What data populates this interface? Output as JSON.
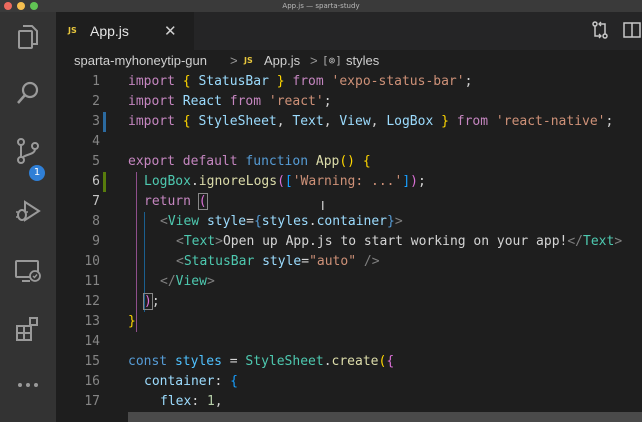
{
  "window": {
    "title": "App.js — sparta-study"
  },
  "tab": {
    "label": "App.js",
    "icon": "JS",
    "close": "✕"
  },
  "breadcrumb": {
    "folder": "sparta-myhoneytip-gun",
    "file": "App.js",
    "symbol": "styles",
    "separator": ">"
  },
  "scm": {
    "badge": "1"
  },
  "line_numbers": [
    "1",
    "2",
    "3",
    "4",
    "5",
    "6",
    "7",
    "8",
    "9",
    "10",
    "11",
    "12",
    "13",
    "14",
    "15",
    "16",
    "17"
  ],
  "code": {
    "l1": {
      "a": "import",
      "b": " { ",
      "c": "StatusBar",
      "d": " } ",
      "e": "from",
      "f": " ",
      "g": "'expo-status-bar'",
      "h": ";"
    },
    "l2": {
      "a": "import",
      "b": " ",
      "c": "React",
      "d": " ",
      "e": "from",
      "f": " ",
      "g": "'react'",
      "h": ";"
    },
    "l3": {
      "a": "import",
      "b": " { ",
      "c": "StyleSheet",
      "d": ", ",
      "e": "Text",
      "f": ", ",
      "g": "View",
      "h": ", ",
      "i": "LogBox",
      "j": " } ",
      "k": "from",
      "l": " ",
      "m": "'react-native'",
      "n": ";"
    },
    "l5": {
      "a": "export",
      "b": " ",
      "c": "default",
      "d": " ",
      "e": "function",
      "f": " ",
      "g": "App",
      "h": "() ",
      "i": "{"
    },
    "l6": {
      "a": "LogBox",
      "b": ".",
      "c": "ignoreLogs",
      "d": "(",
      "e": "[",
      "f": "'Warning: ...'",
      "g": "]",
      "h": ")",
      "i": ";"
    },
    "l7": {
      "a": "return",
      "b": " ",
      "c": "("
    },
    "l8": {
      "a": "<",
      "b": "View",
      "c": " ",
      "d": "style",
      "e": "=",
      "f": "{",
      "g": "styles",
      "h": ".",
      "i": "container",
      "j": "}",
      "k": ">"
    },
    "l9": {
      "a": "<",
      "b": "Text",
      "c": ">",
      "d": "Open up App.js to start working on your app!",
      "e": "</",
      "f": "Text",
      "g": ">"
    },
    "l10": {
      "a": "<",
      "b": "StatusBar",
      "c": " ",
      "d": "style",
      "e": "=",
      "f": "\"auto\"",
      "g": " />"
    },
    "l11": {
      "a": "</",
      "b": "View",
      "c": ">"
    },
    "l12": {
      "a": ")",
      "b": ";"
    },
    "l13": {
      "a": "}"
    },
    "l15": {
      "a": "const",
      "b": " ",
      "c": "styles",
      "d": " = ",
      "e": "StyleSheet",
      "f": ".",
      "g": "create",
      "h": "(",
      "i": "{"
    },
    "l16": {
      "a": "container",
      "b": ": ",
      "c": "{"
    },
    "l17": {
      "a": "flex",
      "b": ": ",
      "c": "1",
      "d": ","
    }
  },
  "colors": {
    "keyword": "#c586c0",
    "storage": "#569cd6",
    "variable": "#9cdcfe",
    "function": "#dcdcaa",
    "string": "#ce9178",
    "type": "#4ec9b0",
    "number": "#b5cea8",
    "badge": "#2f7fd6",
    "modified_gutter": "#2b6aa0",
    "js_icon": "#e8c73d"
  },
  "icons": [
    "explorer-icon",
    "search-icon",
    "source-control-icon",
    "run-debug-icon",
    "remote-explorer-icon",
    "extensions-icon",
    "more-icon",
    "compare-changes-icon",
    "split-editor-icon"
  ]
}
